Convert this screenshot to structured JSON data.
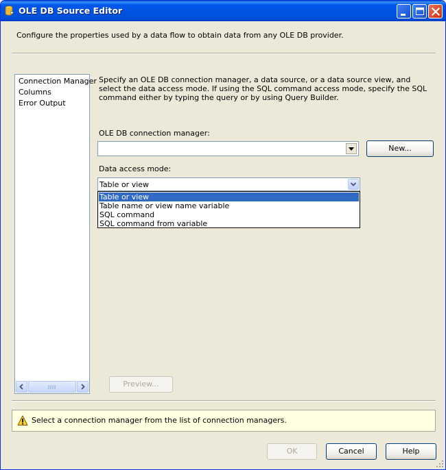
{
  "window": {
    "title": "OLE DB Source Editor",
    "icon": "ssis-source-icon"
  },
  "description": "Configure the properties used by a data flow to obtain data from any OLE DB provider.",
  "nav": {
    "items": [
      {
        "label": "Connection Manager"
      },
      {
        "label": "Columns"
      },
      {
        "label": "Error Output"
      }
    ]
  },
  "main": {
    "help": "Specify an OLE DB connection manager, a data source, or a data source view, and select the data access mode. If using the SQL command access mode, specify the SQL command either by typing the query or by using Query Builder.",
    "connection_label": "OLE DB connection manager:",
    "connection_value": "",
    "new_button": "New...",
    "mode_label": "Data access mode:",
    "mode_value": "Table or view",
    "mode_options": [
      {
        "label": "Table or view",
        "selected": true
      },
      {
        "label": "Table name or view name variable",
        "selected": false
      },
      {
        "label": "SQL command",
        "selected": false
      },
      {
        "label": "SQL command from variable",
        "selected": false
      }
    ],
    "preview_button": "Preview..."
  },
  "status": {
    "icon": "warning-icon",
    "message": "Select a connection manager from the list of connection managers."
  },
  "footer": {
    "ok": "OK",
    "cancel": "Cancel",
    "help": "Help"
  },
  "colors": {
    "titlebar": "#0053E1",
    "dialog_bg": "#ECE9D8",
    "selection": "#316AC5",
    "status_bg": "#FFFFE1"
  }
}
